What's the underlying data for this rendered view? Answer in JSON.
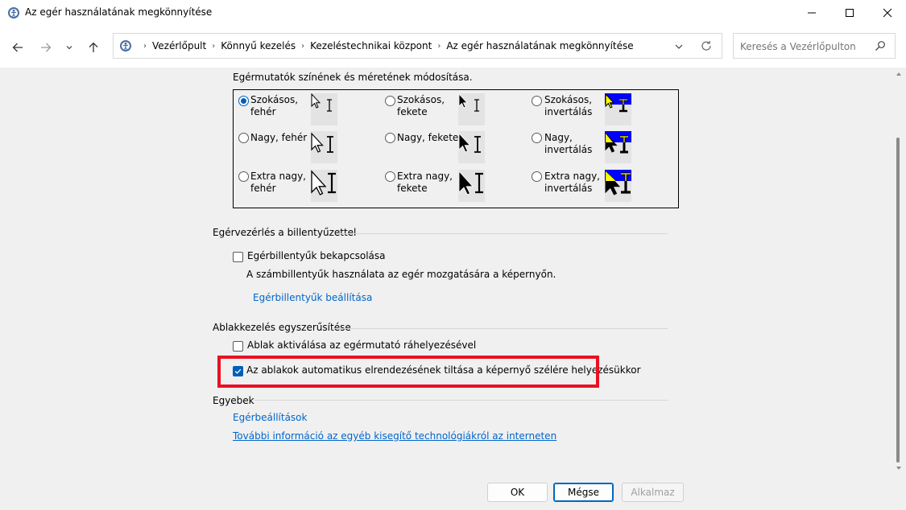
{
  "window": {
    "title": "Az egér használatának megkönnyítése",
    "minimize_icon": "minimize-icon",
    "maximize_icon": "maximize-icon",
    "close_icon": "close-icon"
  },
  "nav": {
    "back_icon": "arrow-left-icon",
    "forward_icon": "arrow-right-icon",
    "recent_icon": "chevron-down-icon",
    "up_icon": "arrow-up-icon",
    "breadcrumbs": [
      "Vezérlőpult",
      "Könnyű kezelés",
      "Kezeléstechnikai központ",
      "Az egér használatának megkönnyítése"
    ],
    "search_placeholder": "Keresés a Vezérlőpulton"
  },
  "cursors": {
    "heading": "Egérmutatók színének és méretének módosítása.",
    "options": [
      {
        "line1": "Szokásos,",
        "line2": "fehér",
        "checked": true
      },
      {
        "line1": "Szokásos,",
        "line2": "fekete",
        "checked": false
      },
      {
        "line1": "Szokásos,",
        "line2": "invertálás",
        "checked": false
      },
      {
        "line1": "Nagy, fehér",
        "line2": "",
        "checked": false
      },
      {
        "line1": "Nagy, fekete",
        "line2": "",
        "checked": false
      },
      {
        "line1": "Nagy,",
        "line2": "invertálás",
        "checked": false
      },
      {
        "line1": "Extra nagy,",
        "line2": "fehér",
        "checked": false
      },
      {
        "line1": "Extra nagy,",
        "line2": "fekete",
        "checked": false
      },
      {
        "line1": "Extra nagy,",
        "line2": "invertálás",
        "checked": false
      }
    ]
  },
  "keyboard_section": {
    "title": "Egérvezérlés a billentyűzettel",
    "mousekeys_label": "Egérbillentyűk bekapcsolása",
    "mousekeys_checked": false,
    "description": "A számbillentyűk használata az egér mozgatására a képernyőn.",
    "setup_link": "Egérbillentyűk beállítása"
  },
  "window_section": {
    "title": "Ablakkezelés egyszerűsítése",
    "hover_activate_label": "Ablak aktiválása az egérmutató ráhelyezésével",
    "hover_activate_checked": false,
    "snap_prevent_label": "Az ablakok automatikus elrendezésének tiltása a képernyő szélére helyezésükkor",
    "snap_prevent_checked": true
  },
  "other_section": {
    "title": "Egyebek",
    "mouse_settings_link": "Egérbeállítások",
    "more_info_link": "További információ az egyéb kisegítő technológiákról az interneten"
  },
  "buttons": {
    "ok": "OK",
    "cancel": "Mégse",
    "apply": "Alkalmaz"
  },
  "colors": {
    "accent": "#005fb8",
    "link": "#0066cc",
    "highlight": "#e81123"
  }
}
